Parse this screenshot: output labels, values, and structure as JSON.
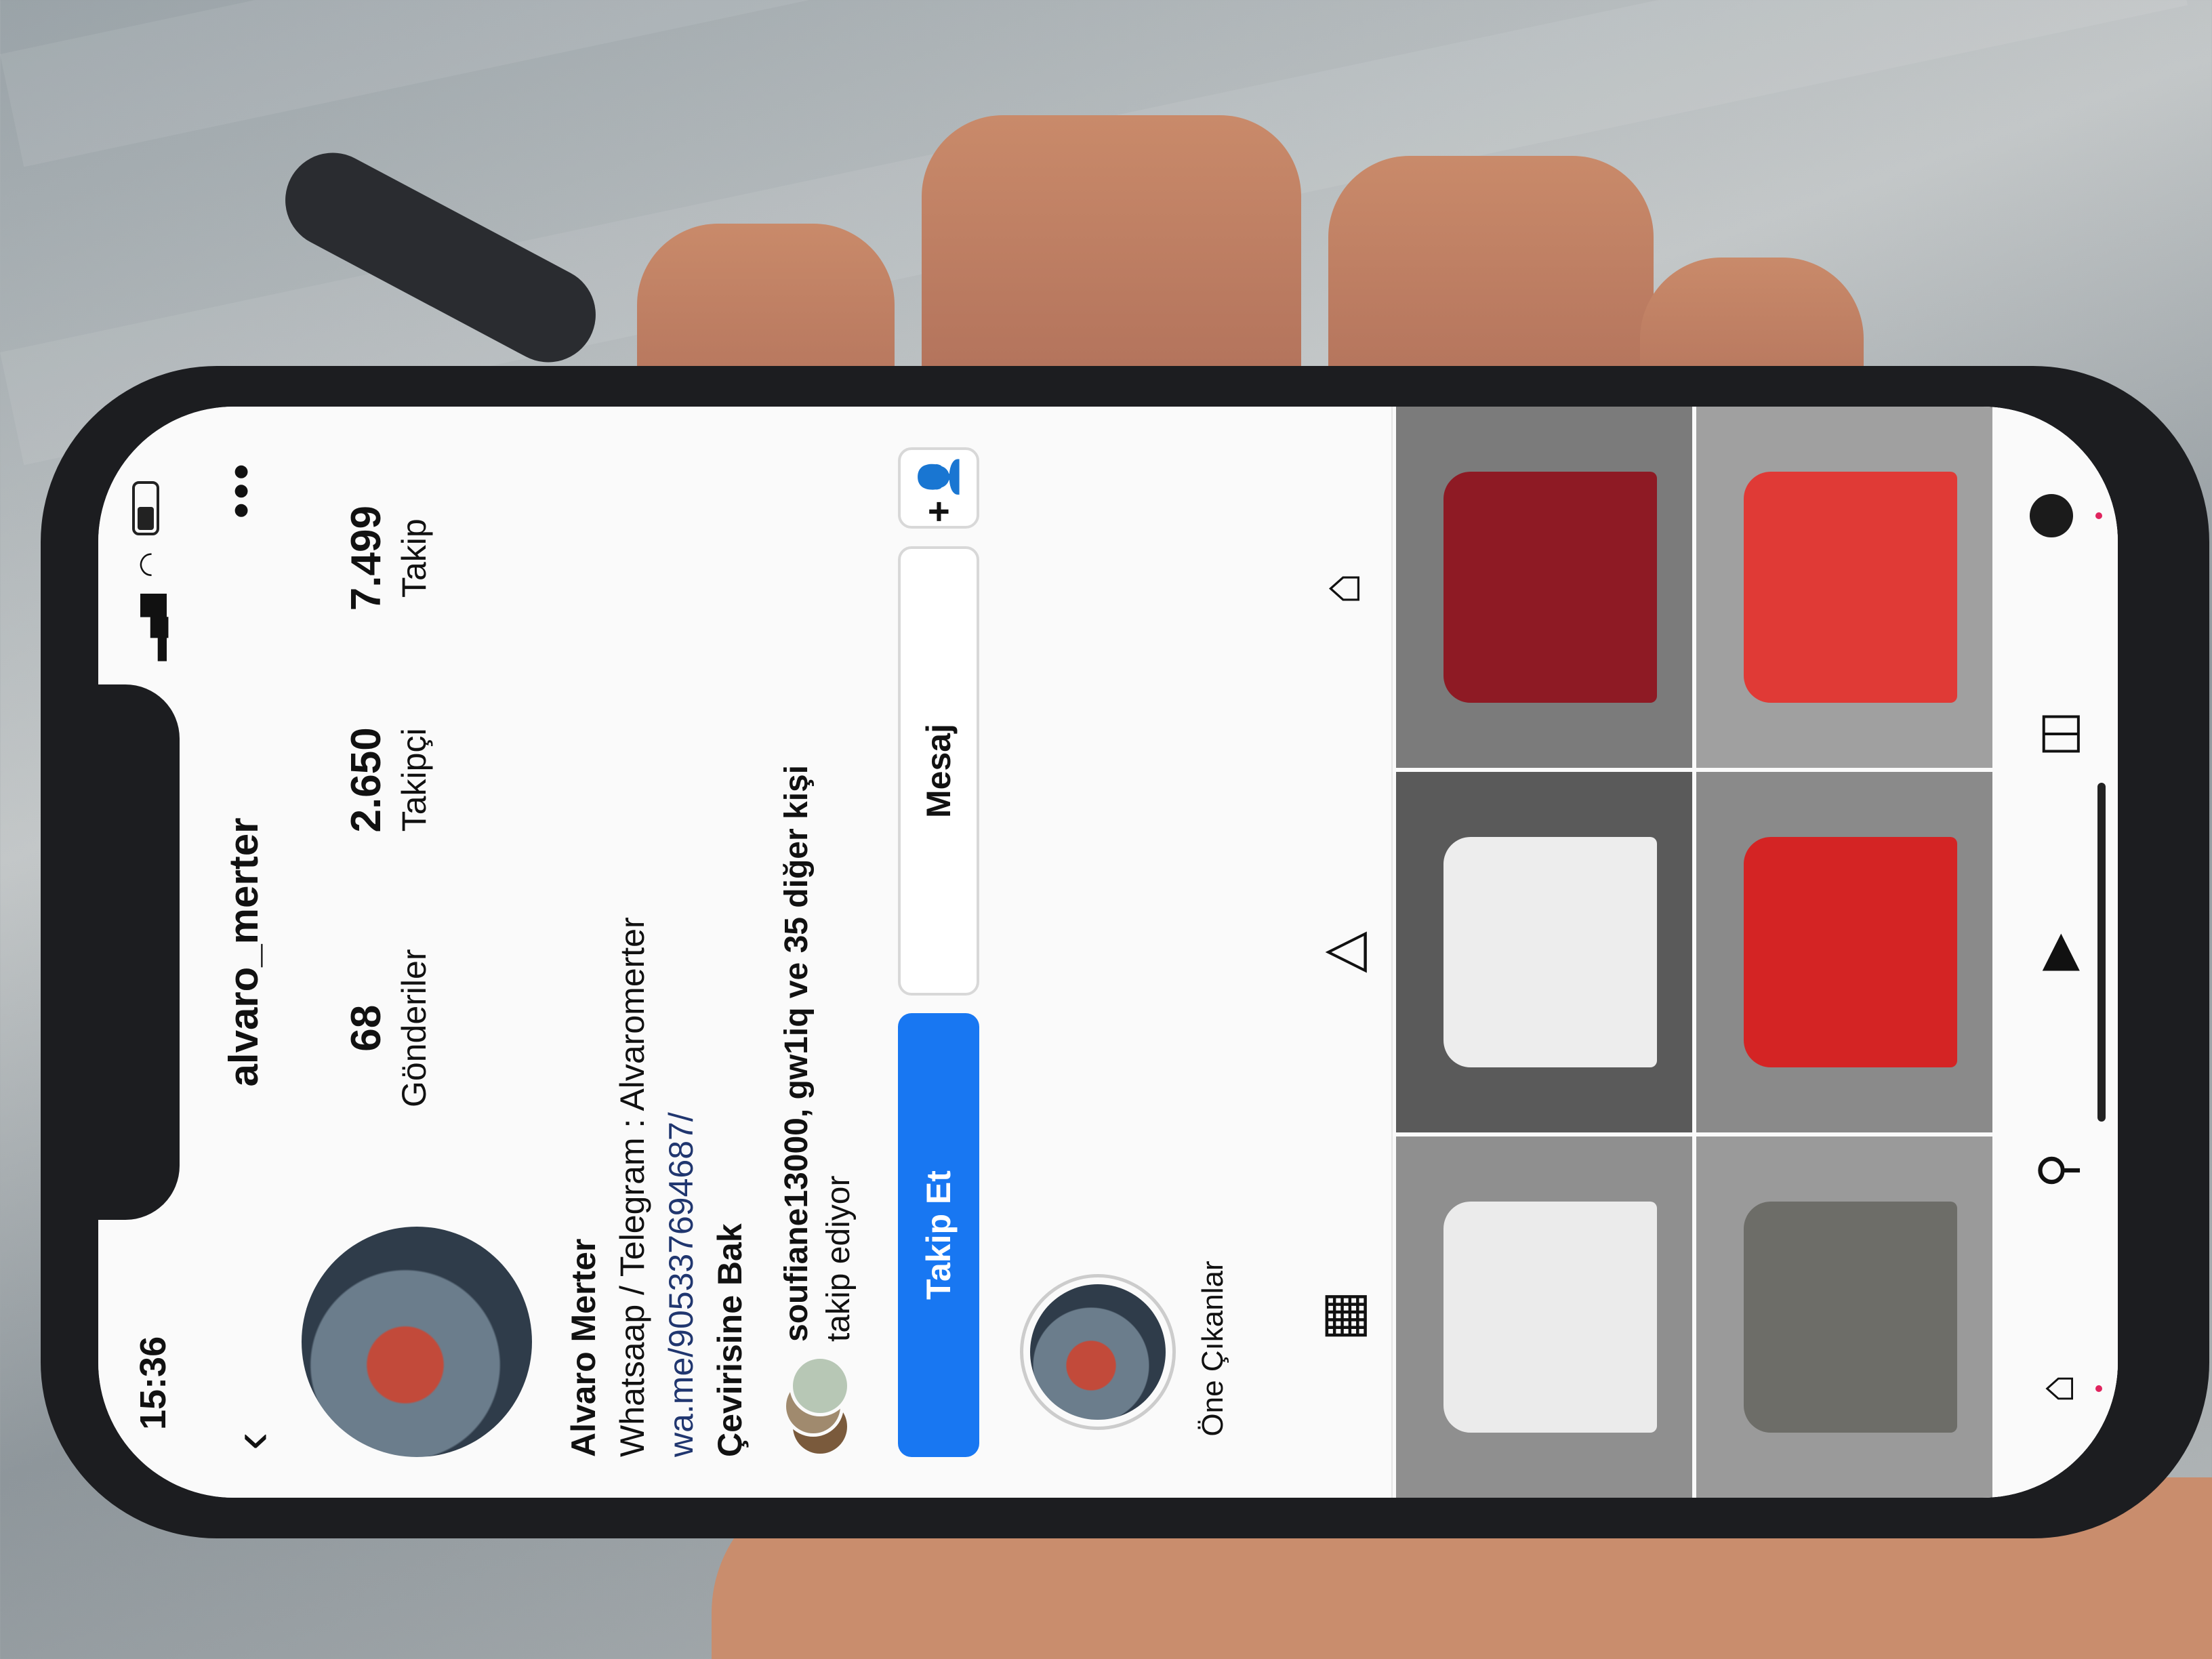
{
  "status_bar": {
    "time": "15:36",
    "signal_icon": "cellular-signal-icon",
    "wifi_icon": "wifi-icon",
    "battery_icon": "battery-icon"
  },
  "nav": {
    "back_icon": "chevron-left-icon",
    "username": "alvaro_merter",
    "more_icon": "more-dots-icon"
  },
  "profile": {
    "stats": [
      {
        "count": "68",
        "label": "Gönderiler"
      },
      {
        "count": "2.650",
        "label": "Takipçi"
      },
      {
        "count": "7.499",
        "label": "Takip"
      }
    ],
    "display_name": "Alvaro Merter",
    "bio_line": "Whatsaap / Telegram : Alvaromerter",
    "bio_link": "wa.me/905337694687/",
    "translate_label": "Çevirisine Bak",
    "followed_by_text": "soufiane13000, gw1iq ve 35 diğer kişi",
    "followed_by_suffix": "takip ediyor"
  },
  "actions": {
    "follow_label": "Takip Et",
    "message_label": "Mesaj",
    "add_user_icon": "add-person-icon"
  },
  "highlights": [
    {
      "label": "Öne Çıkanlar"
    }
  ],
  "tabs": [
    {
      "icon": "grid-icon",
      "active": true
    },
    {
      "icon": "play-triangle-icon",
      "active": false
    },
    {
      "icon": "tagged-person-icon",
      "active": false
    }
  ],
  "posts": [
    {
      "shirt_color": "#ebebeb",
      "bg": "#8f8f8f"
    },
    {
      "shirt_color": "#ededed",
      "bg": "#5a5a5a"
    },
    {
      "shirt_color": "#8e1a24",
      "bg": "#7b7b7b"
    },
    {
      "shirt_color": "#6d6d68",
      "bg": "#9a9a9a"
    },
    {
      "shirt_color": "#d42424",
      "bg": "#8a8a8a"
    },
    {
      "shirt_color": "#e03a36",
      "bg": "#a0a0a0"
    }
  ],
  "bottom_nav": [
    {
      "icon": "home-icon",
      "dot": true
    },
    {
      "icon": "search-icon",
      "dot": false
    },
    {
      "icon": "reels-icon",
      "dot": false
    },
    {
      "icon": "shop-icon",
      "dot": false
    },
    {
      "icon": "profile-avatar",
      "dot": true
    }
  ]
}
